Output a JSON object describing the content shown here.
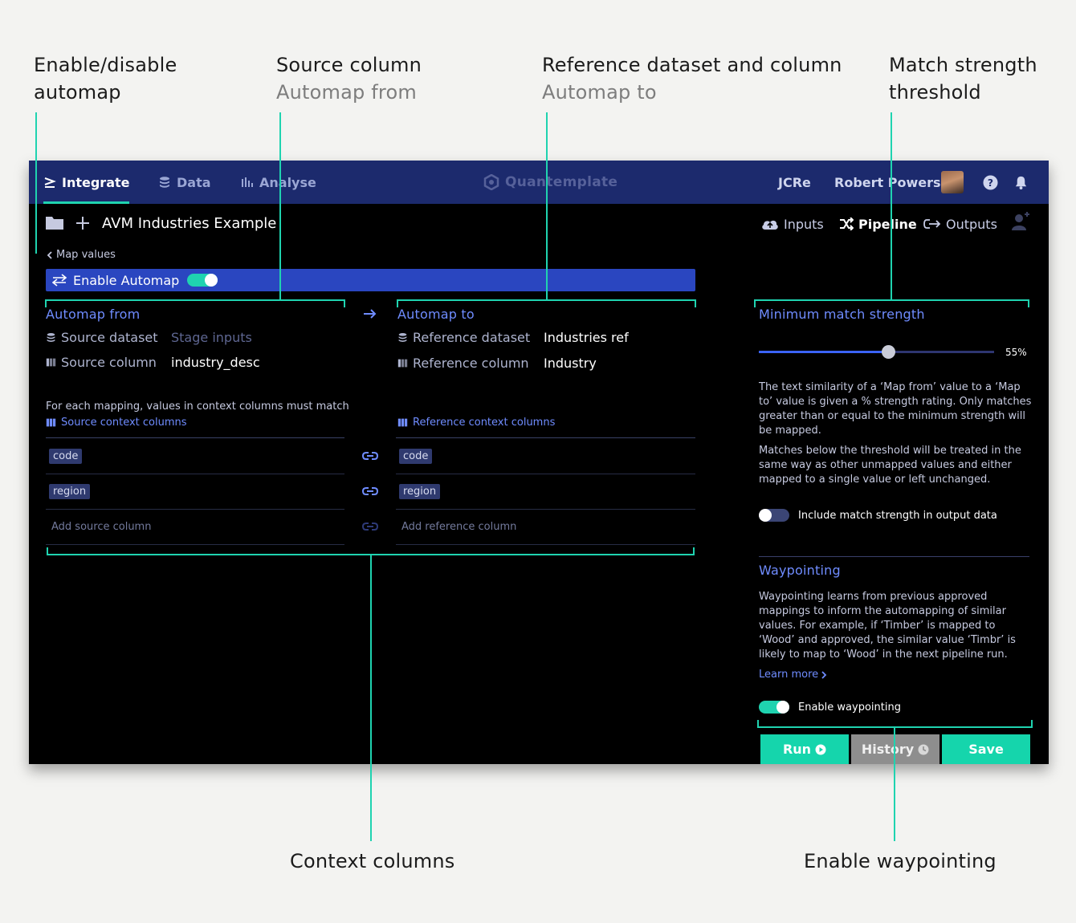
{
  "annotations": {
    "automap_toggle": {
      "line1": "Enable/disable",
      "line2": "automap"
    },
    "source_column": {
      "title": "Source column",
      "sub": "Automap from"
    },
    "reference": {
      "title": "Reference dataset and column",
      "sub": "Automap to"
    },
    "match_strength": {
      "line1": "Match strength",
      "line2": "threshold"
    },
    "context_columns": "Context columns",
    "enable_waypointing": "Enable waypointing"
  },
  "topbar": {
    "nav": [
      {
        "label": "Integrate",
        "icon": "integrate-icon",
        "active": true
      },
      {
        "label": "Data",
        "icon": "database-icon",
        "active": false
      },
      {
        "label": "Analyse",
        "icon": "bar-chart-icon",
        "active": false
      }
    ],
    "brand": "Quantemplate",
    "org": "JCRe",
    "user": "Robert Powers",
    "icons": [
      "help-icon",
      "bell-icon"
    ]
  },
  "project": {
    "title": "AVM Industries Example",
    "tabs": [
      {
        "label": "Inputs",
        "icon": "cloud-upload-icon"
      },
      {
        "label": "Pipeline",
        "icon": "shuffle-icon"
      },
      {
        "label": "Outputs",
        "icon": "export-icon"
      }
    ]
  },
  "back_link": "Map values",
  "automap": {
    "label": "Enable Automap",
    "enabled": true
  },
  "from": {
    "title": "Automap from",
    "dataset_label": "Source dataset",
    "dataset_value": "Stage inputs",
    "column_label": "Source column",
    "column_value": "industry_desc"
  },
  "to": {
    "title": "Automap to",
    "dataset_label": "Reference dataset",
    "dataset_value": "Industries ref",
    "column_label": "Reference column",
    "column_value": "Industry"
  },
  "context": {
    "help": "For each mapping, values in context columns must match",
    "source_label": "Source context columns",
    "reference_label": "Reference context columns",
    "source_columns": [
      "code",
      "region"
    ],
    "reference_columns": [
      "code",
      "region"
    ],
    "add_source": "Add source column",
    "add_reference": "Add reference column"
  },
  "match": {
    "title": "Minimum match strength",
    "value_label": "55%",
    "value": 0.55,
    "text1": "The text similarity of a ‘Map from’ value to a ‘Map to’ value is given a % strength rating. Only matches greater than or equal to the minimum strength will be mapped.",
    "text2": "Matches below the threshold will be treated in the same way as other unmapped values and either mapped to a single value or left unchanged.",
    "include_label": "Include match strength in output data",
    "include_enabled": false
  },
  "waypointing": {
    "title": "Waypointing",
    "text": "Waypointing learns from previous approved mappings to inform the automapping of similar values. For example, if ‘Timber’ is mapped to ‘Wood’ and approved, the similar value ‘Timbr’ is likely to map to ‘Wood’ in the next pipeline run.",
    "learn_more": "Learn more",
    "enable_label": "Enable waypointing",
    "enabled": true
  },
  "buttons": {
    "run": "Run",
    "history": "History",
    "save": "Save"
  },
  "colors": {
    "accent": "#1fd3b0",
    "nav": "#1c2a6d",
    "link": "#6f8cff",
    "automap_bar": "#2a46c0"
  }
}
